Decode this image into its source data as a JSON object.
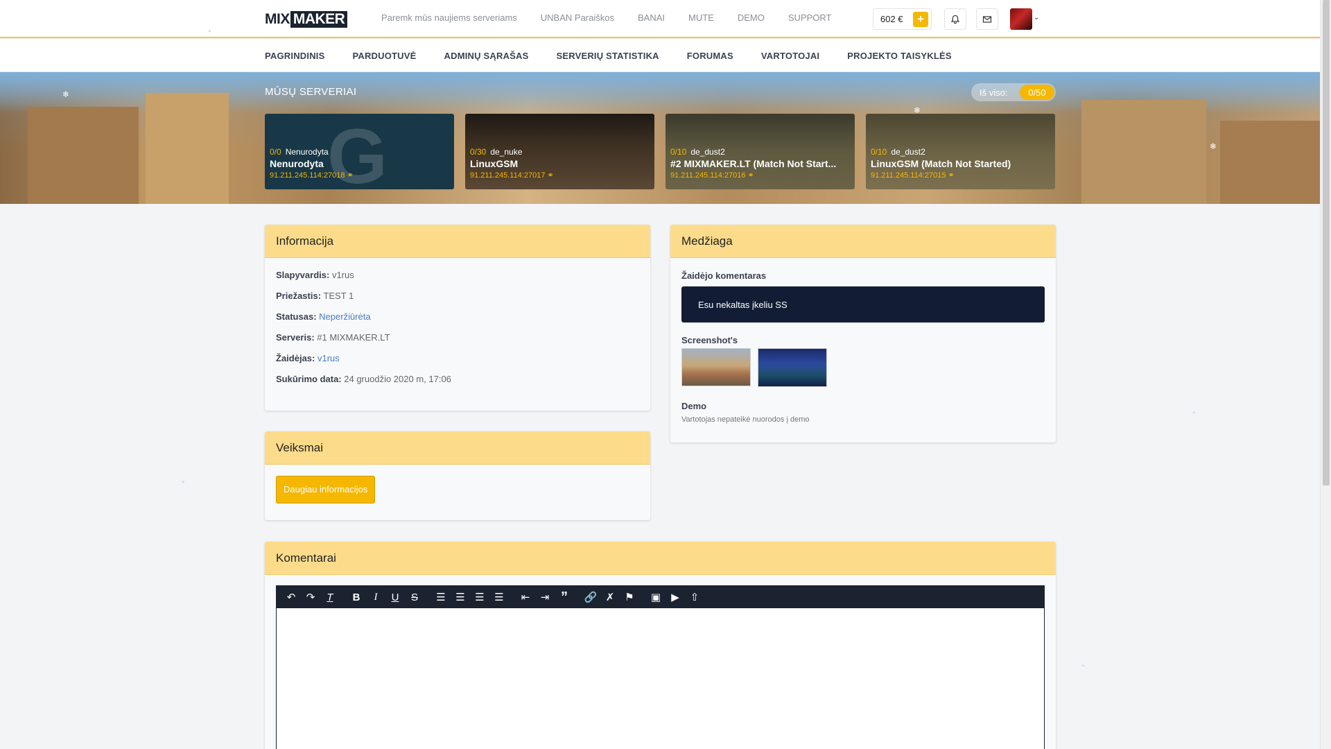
{
  "header": {
    "logo_part1": "MIX",
    "logo_part2": "MAKER",
    "nav": [
      "Paremk mūs naujiems serveriams",
      "UNBAN Paraiškos",
      "BANAI",
      "MUTE",
      "DEMO",
      "SUPPORT"
    ],
    "balance": "602 €",
    "add_label": "+",
    "notifications_icon": "bell-icon",
    "messages_icon": "envelope-icon"
  },
  "mainnav": [
    "PAGRINDINIS",
    "PARDUOTUVĖ",
    "ADMINŲ SĄRAŠAS",
    "SERVERIŲ STATISTIKA",
    "FORUMAS",
    "VARTOTOJAI",
    "PROJEKTO TAISYKLĖS"
  ],
  "servers_section": {
    "title": "MŪSŲ SERVERIAI",
    "total_label": "Iš viso:",
    "total_value": "0/50",
    "servers": [
      {
        "count": "0/0",
        "map": "Nenurodyta",
        "name": "Nenurodyta",
        "ip": "91.211.245.114:27018"
      },
      {
        "count": "0/30",
        "map": "de_nuke",
        "name": "LinuxGSM",
        "ip": "91.211.245.114:27017"
      },
      {
        "count": "0/10",
        "map": "de_dust2",
        "name": "#2 MIXMAKER.LT (Match Not Start...",
        "ip": "91.211.245.114:27016"
      },
      {
        "count": "0/10",
        "map": "de_dust2",
        "name": "LinuxGSM (Match Not Started)",
        "ip": "91.211.245.114:27015"
      }
    ]
  },
  "info": {
    "title": "Informacija",
    "rows": [
      {
        "label": "Slapyvardis:",
        "value": "v1rus"
      },
      {
        "label": "Priežastis:",
        "value": "TEST 1"
      },
      {
        "label": "Statusas:",
        "value": "Neperžiūrėta"
      },
      {
        "label": "Serveris:",
        "value": "#1 MIXMAKER.LT"
      },
      {
        "label": "Žaidėjas:",
        "value": "v1rus"
      },
      {
        "label": "Sukūrimo data:",
        "value": "24 gruodžio 2020 m, 17:06"
      }
    ]
  },
  "actions": {
    "title": "Veiksmai",
    "more_button": "Daugiau informacijos"
  },
  "media": {
    "title": "Medžiaga",
    "comment_label": "Žaidėjo komentaras",
    "comment_text": "Esu nekaltas įkeliu SS",
    "screenshots_label": "Screenshot's",
    "demo_label": "Demo",
    "demo_note": "Vartotojas nepateikė nuorodos į demo"
  },
  "comments": {
    "title": "Komentarai"
  },
  "colors": {
    "accent": "#f5b700",
    "card_header": "#fcdc8a",
    "dark": "#1b2330"
  }
}
